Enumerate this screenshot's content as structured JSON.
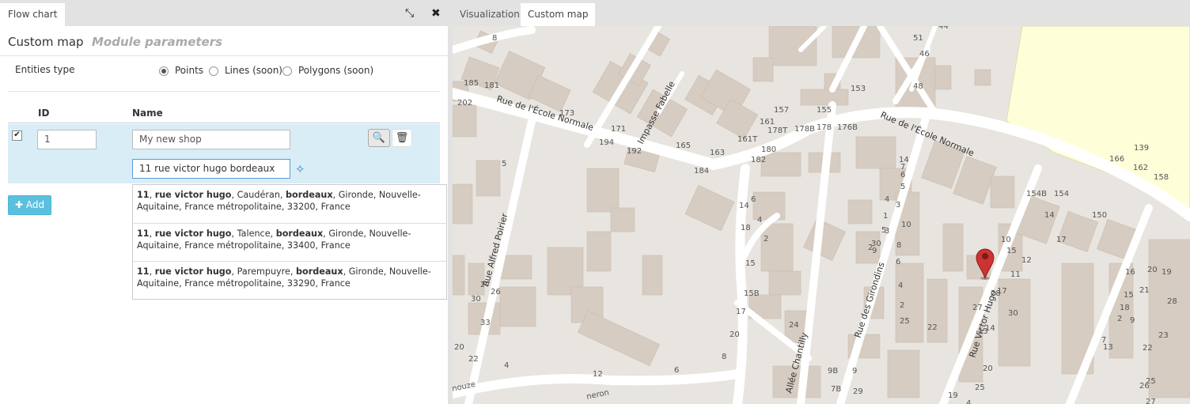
{
  "left_tabs": {
    "flow_chart": "Flow chart"
  },
  "panel": {
    "title": "Custom map",
    "subtitle": "Module parameters"
  },
  "entities": {
    "label": "Entities type",
    "options": [
      {
        "label": "Points",
        "selected": true
      },
      {
        "label": "Lines (soon)",
        "selected": false
      },
      {
        "label": "Polygons (soon)",
        "selected": false
      }
    ]
  },
  "table": {
    "headers": {
      "id": "ID",
      "name": "Name"
    },
    "row": {
      "id": "1",
      "name": "My new shop",
      "address": "11 rue victor hugo bordeaux",
      "checked": true
    }
  },
  "add_button": {
    "label": "Add"
  },
  "suggestions": [
    {
      "number": "11",
      "street": "rue victor hugo",
      "area": "Caudéran",
      "city": "bordeaux",
      "rest": "Gironde, Nouvelle-Aquitaine, France métropolitaine, 33200, France"
    },
    {
      "number": "11",
      "street": "rue victor hugo",
      "area": "Talence",
      "city": "bordeaux",
      "rest": "Gironde, Nouvelle-Aquitaine, France métropolitaine, 33400, France"
    },
    {
      "number": "11",
      "street": "rue victor hugo",
      "area": "Parempuyre",
      "city": "bordeaux",
      "rest": "Gironde, Nouvelle-Aquitaine, France métropolitaine, 33290, France"
    }
  ],
  "right_tabs": {
    "visualization": "Visualization",
    "custom_map": "Custom map"
  },
  "map": {
    "street_names": [
      "Rue de l'École Normale",
      "Rue de l'École Normale",
      "Impasse Fabelle",
      "Rue Alfred Poirier",
      "Rue des Girondins",
      "Rue Victor Hugo",
      "Allée Chantilly"
    ],
    "house_numbers": [
      "8",
      "185",
      "181",
      "202",
      "173",
      "171",
      "194",
      "192",
      "165",
      "163",
      "184",
      "161",
      "161T",
      "180",
      "182",
      "157",
      "155",
      "178T",
      "178B",
      "178",
      "176B",
      "153",
      "139",
      "166",
      "162",
      "158",
      "154B",
      "154",
      "150",
      "51",
      "46",
      "48",
      "44",
      "6",
      "4",
      "2",
      "5",
      "7",
      "6",
      "5",
      "4",
      "3",
      "2",
      "5",
      "9",
      "10",
      "8",
      "6",
      "4",
      "2",
      "25",
      "22",
      "27",
      "26",
      "30",
      "33",
      "20",
      "22",
      "14",
      "18",
      "15",
      "15B",
      "17",
      "20",
      "24",
      "9B",
      "7B",
      "9",
      "29",
      "30",
      "1",
      "3",
      "4",
      "6",
      "8",
      "12",
      "14",
      "10",
      "15",
      "11",
      "17",
      "28",
      "30",
      "27",
      "13",
      "14",
      "19",
      "20",
      "25",
      "4",
      "2",
      "9",
      "7",
      "13",
      "12",
      "14",
      "17",
      "16",
      "15",
      "18",
      "19",
      "20",
      "21",
      "23",
      "22",
      "25",
      "26",
      "27",
      "28",
      "29"
    ],
    "pin_color": "#cc3333",
    "edge_labels": [
      "nouze",
      "neron"
    ]
  },
  "icons": {
    "expand": "expand-icon",
    "close": "close-icon",
    "search": "search-icon",
    "trash": "trash-icon",
    "locate": "crosshair-icon",
    "plus": "plus-icon",
    "pin": "map-pin-icon"
  }
}
